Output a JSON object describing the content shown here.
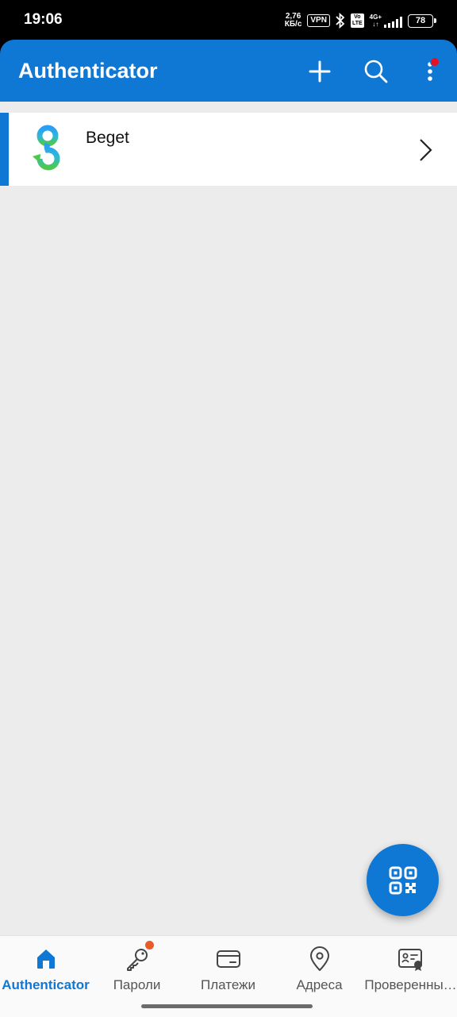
{
  "status_bar": {
    "time": "19:06",
    "net_speed_value": "2,76",
    "net_speed_unit": "КБ/с",
    "vpn": "VPN",
    "volte_top": "Vo",
    "volte_bottom": "LTE",
    "network": "4G+",
    "battery": "78"
  },
  "app_bar": {
    "title": "Authenticator",
    "icons": [
      "plus-icon",
      "search-icon",
      "more-vertical-icon"
    ],
    "accent_color": "#0f78d4",
    "notification_dot_color": "#e81123"
  },
  "accounts": [
    {
      "name": "Beget",
      "icon": "beget-logo"
    }
  ],
  "fab": {
    "icon": "qr-code-scan-icon"
  },
  "bottom_nav": {
    "items": [
      {
        "label": "Authenticator",
        "icon": "home-icon",
        "active": true
      },
      {
        "label": "Пароли",
        "icon": "key-icon",
        "badge": true
      },
      {
        "label": "Платежи",
        "icon": "credit-card-icon"
      },
      {
        "label": "Адреса",
        "icon": "location-pin-icon"
      },
      {
        "label": "Проверенны…",
        "icon": "verified-id-icon"
      }
    ]
  }
}
